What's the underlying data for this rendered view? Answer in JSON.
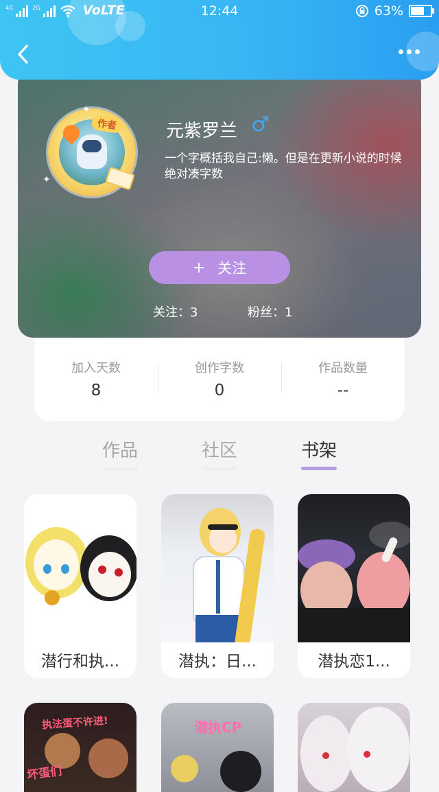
{
  "status_bar": {
    "network_left": "4G",
    "network_right": "2G",
    "volte": "VoLTE",
    "time": "12:44",
    "battery": "63%"
  },
  "profile": {
    "username": "元紫罗兰",
    "gender_symbol": "♂",
    "bio": "一个字概括我自己:懒。但是在更新小说的时候绝对凑字数",
    "avatar_badge": "作者",
    "follow_plus": "+",
    "follow_label": "关注",
    "following": "关注：3",
    "followers": "粉丝：1"
  },
  "stats": [
    {
      "label": "加入天数",
      "value": "8"
    },
    {
      "label": "创作字数",
      "value": "0"
    },
    {
      "label": "作品数量",
      "value": "--"
    }
  ],
  "tabs": [
    {
      "label": "作品",
      "active": false
    },
    {
      "label": "社区",
      "active": false
    },
    {
      "label": "书架",
      "active": true
    }
  ],
  "bookshelf": [
    {
      "title": "潜行和执..."
    },
    {
      "title": "潜执：日..."
    },
    {
      "title": "潜执恋1..."
    }
  ],
  "bookshelf_row2_cover_text": {
    "left": "执法蛋不许进!",
    "left_bottom": "坏蛋们",
    "middle": "潜执CP"
  },
  "colors": {
    "header": "#38b6f4",
    "follow_button": "#b991e4",
    "active_tab_indicator": "#b69ce2",
    "gender": "#3fa8f2"
  }
}
